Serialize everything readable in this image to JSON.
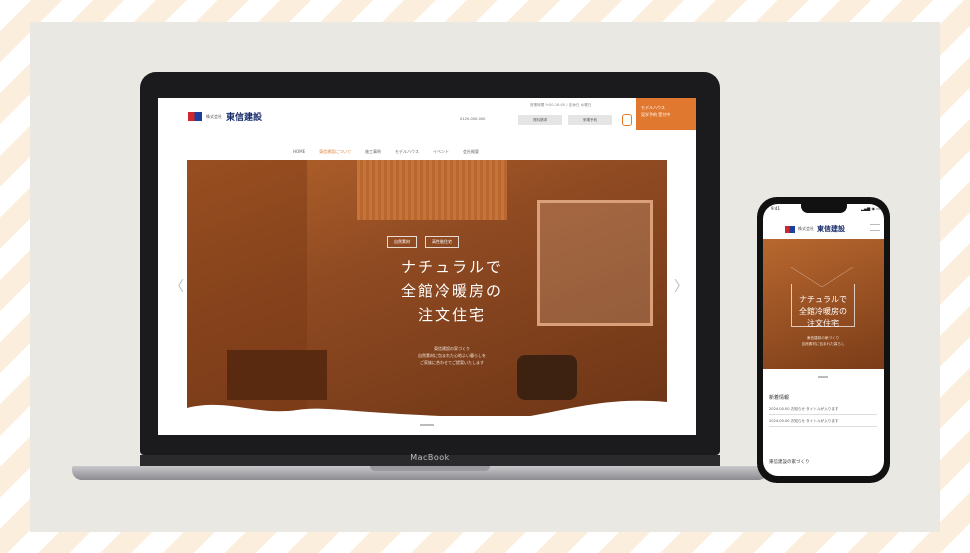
{
  "laptop": {
    "brand": "MacBook",
    "site": {
      "logo_prefix": "株式会社",
      "logo_name": "東信建設",
      "contact_line": "営業時間 9:00-18:00 / 定休日 水曜日",
      "tel": "0120-000-000",
      "header_buttons": [
        "資料請求",
        "来場予約"
      ],
      "cta_lines": [
        "モデルハウス",
        "見学予約 受付中"
      ],
      "nav": [
        "HOME",
        "東信建設について",
        "施工事例",
        "モデルハウス",
        "イベント",
        "会社概要"
      ],
      "nav_active_index": 1,
      "hero_tags": [
        "自然素材",
        "高性能住宅"
      ],
      "hero_title_lines": [
        "ナチュラルで",
        "全館冷暖房の",
        "注文住宅"
      ],
      "hero_sub_lines": [
        "東信建設の家づくり",
        "自然素材に包まれた心地よい暮らしを",
        "ご家族に合わせてご提案いたします"
      ],
      "arrow_left": "〈",
      "arrow_right": "〉"
    }
  },
  "phone": {
    "time": "9:41",
    "status_icons": "▂▄▆ ◉ ▭",
    "logo_prefix": "株式会社",
    "logo_name": "東信建設",
    "hero_title_lines": [
      "ナチュラルで",
      "全館冷暖房の",
      "注文住宅"
    ],
    "hero_sub_lines": [
      "東信建設の家づくり",
      "自然素材に包まれた暮らし"
    ],
    "news_title": "新着情報",
    "news_items": [
      "2024.00.00 お知らせ タイトルが入ります",
      "2024.00.00 お知らせ タイトルが入ります"
    ],
    "section_title": "東信建設の家づくり"
  },
  "colors": {
    "accent": "#e1782f",
    "logo_navy": "#1a2e6c"
  }
}
